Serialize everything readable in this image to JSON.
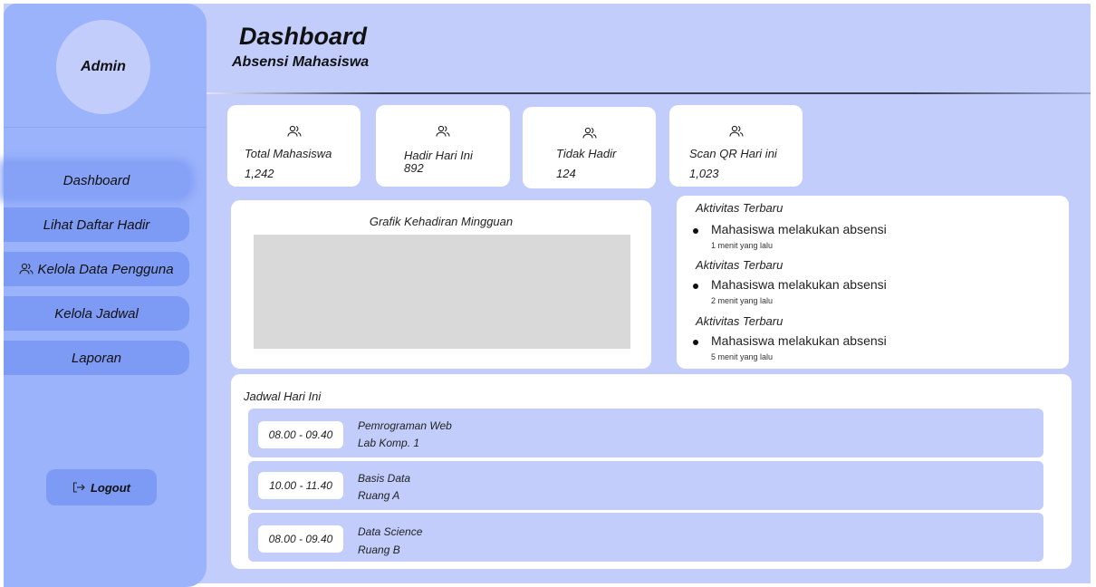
{
  "sidebar": {
    "avatar_label": "Admin",
    "nav": [
      {
        "label": "Dashboard"
      },
      {
        "label": "Lihat Daftar Hadir"
      },
      {
        "label": "Kelola Data Pengguna",
        "icon": "users-icon"
      },
      {
        "label": "Kelola Jadwal"
      },
      {
        "label": "Laporan"
      }
    ],
    "logout_label": "Logout"
  },
  "header": {
    "title": "Dashboard",
    "subtitle": "Absensi Mahasiswa"
  },
  "stats": [
    {
      "label": "Total Mahasiswa",
      "value": "1,242",
      "icon": "users-icon"
    },
    {
      "label": "Hadir Hari Ini",
      "value": "892",
      "icon": "users-icon"
    },
    {
      "label": "Tidak Hadir",
      "value": "124",
      "icon": "users-icon"
    },
    {
      "label": "Scan QR Hari ini",
      "value": "1,023",
      "icon": "users-icon"
    }
  ],
  "chart": {
    "title": "Grafik Kehadiran Mingguan"
  },
  "activity": [
    {
      "heading": "Aktivitas Terbaru",
      "text": "Mahasiswa melakukan absensi",
      "time": "1 menit yang lalu"
    },
    {
      "heading": "Aktivitas Terbaru",
      "text": "Mahasiswa melakukan absensi",
      "time": "2 menit yang lalu"
    },
    {
      "heading": "Aktivitas Terbaru",
      "text": "Mahasiswa melakukan absensi",
      "time": "5 menit yang lalu"
    }
  ],
  "schedule": {
    "title": "Jadwal Hari Ini",
    "rows": [
      {
        "time": "08.00 - 09.40",
        "course": "Pemrograman Web",
        "room": "Lab Komp. 1"
      },
      {
        "time": "10.00 - 11.40",
        "course": "Basis Data",
        "room": "Ruang A"
      },
      {
        "time": "08.00 - 09.40",
        "course": "Data Science",
        "room": "Ruang B"
      }
    ]
  },
  "colors": {
    "background": "#c2cdfb",
    "sidebar": "#9bb3fb",
    "nav_button": "#7d9af5",
    "card": "#ffffff",
    "chart_placeholder": "#d9d9d9"
  }
}
